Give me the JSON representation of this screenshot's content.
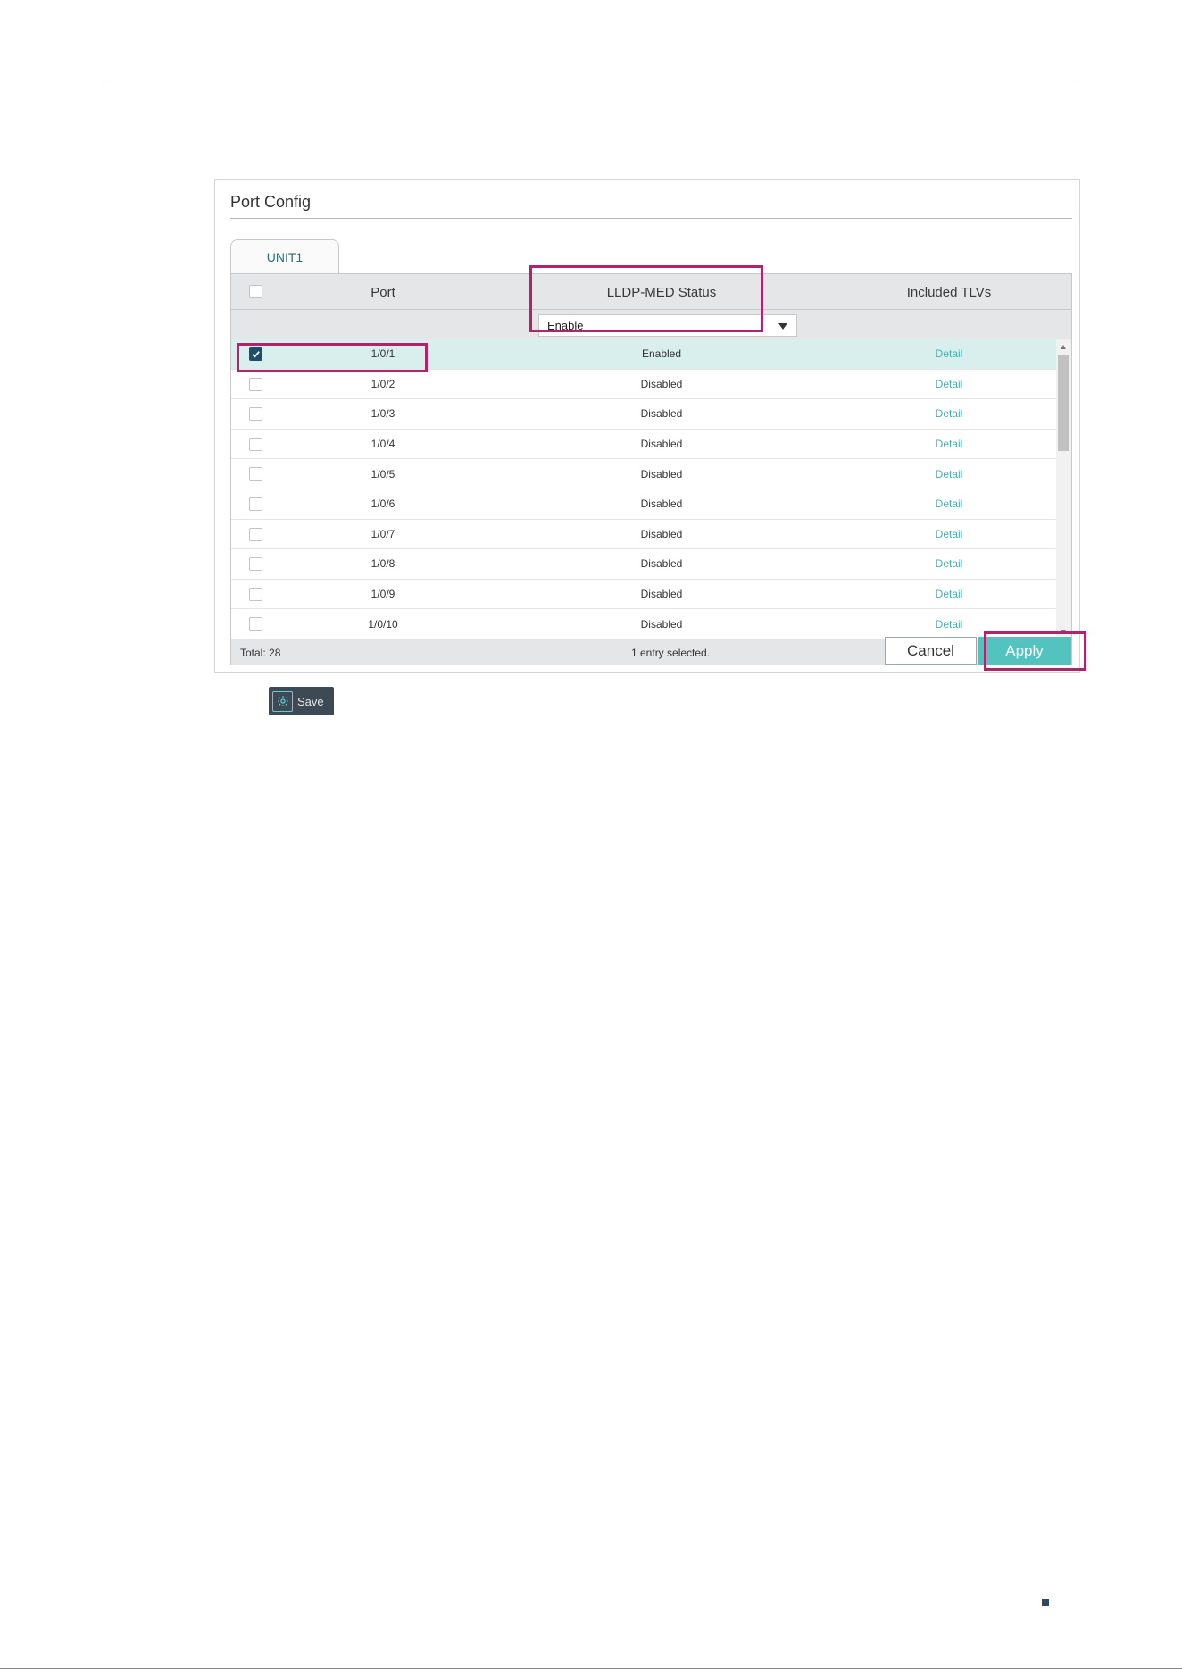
{
  "panel": {
    "title": "Port Config",
    "tab_label": "UNIT1"
  },
  "table": {
    "columns": [
      "Port",
      "LLDP-MED Status",
      "Included TLVs"
    ],
    "filter": {
      "status_value": "Enable"
    },
    "rows": [
      {
        "port": "1/0/1",
        "status": "Enabled",
        "tlvs": "Detail",
        "checked": true
      },
      {
        "port": "1/0/2",
        "status": "Disabled",
        "tlvs": "Detail",
        "checked": false
      },
      {
        "port": "1/0/3",
        "status": "Disabled",
        "tlvs": "Detail",
        "checked": false
      },
      {
        "port": "1/0/4",
        "status": "Disabled",
        "tlvs": "Detail",
        "checked": false
      },
      {
        "port": "1/0/5",
        "status": "Disabled",
        "tlvs": "Detail",
        "checked": false
      },
      {
        "port": "1/0/6",
        "status": "Disabled",
        "tlvs": "Detail",
        "checked": false
      },
      {
        "port": "1/0/7",
        "status": "Disabled",
        "tlvs": "Detail",
        "checked": false
      },
      {
        "port": "1/0/8",
        "status": "Disabled",
        "tlvs": "Detail",
        "checked": false
      },
      {
        "port": "1/0/9",
        "status": "Disabled",
        "tlvs": "Detail",
        "checked": false
      },
      {
        "port": "1/0/10",
        "status": "Disabled",
        "tlvs": "Detail",
        "checked": false
      }
    ],
    "footer": {
      "total": "Total: 28",
      "selected_info": "1 entry selected."
    }
  },
  "buttons": {
    "cancel": "Cancel",
    "apply": "Apply",
    "save": "Save"
  },
  "icons": {
    "save": "gear-icon",
    "dropdown": "chevron-down-icon",
    "checkbox_checked": "checkmark-icon"
  },
  "colors": {
    "accent": "#52c3be",
    "link": "#3bb6b2",
    "highlight": "#b0246a",
    "selected_row": "#d9efed",
    "checkbox_checked": "#1f4e6b"
  }
}
